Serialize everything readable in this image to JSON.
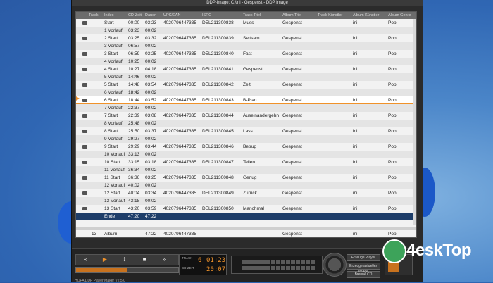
{
  "window": {
    "title": "DDP-Image: C:\\ini - Gespenst - DDP Image"
  },
  "table": {
    "headers": [
      "Track",
      "Index",
      "CD-Zeit",
      "Dauer",
      "UPC/EAN",
      "ISRC",
      "Track Titel",
      "Album Titel",
      "Track Künstler",
      "Album Künstler",
      "Album Genre"
    ],
    "rows": [
      {
        "index": "Start",
        "cd": "00:00",
        "dur": "03:23",
        "upc": "4020796447335",
        "isrc": "DEL211300838",
        "title": "Muss",
        "album": "Gespenst",
        "artist": "ini",
        "genre": "Pop"
      },
      {
        "index": "1 Vorlauf",
        "cd": "03:23",
        "dur": "00:02"
      },
      {
        "index": "2 Start",
        "cd": "03:25",
        "dur": "03:32",
        "upc": "4020796447335",
        "isrc": "DEL211300839",
        "title": "Seltsam",
        "album": "Gespenst",
        "artist": "ini",
        "genre": "Pop"
      },
      {
        "index": "3 Vorlauf",
        "cd": "06:57",
        "dur": "00:02"
      },
      {
        "index": "3 Start",
        "cd": "06:59",
        "dur": "03:25",
        "upc": "4020796447335",
        "isrc": "DEL211300840",
        "title": "Fast",
        "album": "Gespenst",
        "artist": "ini",
        "genre": "Pop"
      },
      {
        "index": "4 Vorlauf",
        "cd": "10:25",
        "dur": "00:02"
      },
      {
        "index": "4 Start",
        "cd": "10:27",
        "dur": "04:18",
        "upc": "4020796447335",
        "isrc": "DEL211300841",
        "title": "Gespenst",
        "album": "Gespenst",
        "artist": "ini",
        "genre": "Pop"
      },
      {
        "index": "5 Vorlauf",
        "cd": "14:46",
        "dur": "00:02"
      },
      {
        "index": "5 Start",
        "cd": "14:48",
        "dur": "03:54",
        "upc": "4020796447335",
        "isrc": "DEL211300842",
        "title": "Zeit",
        "album": "Gespenst",
        "artist": "ini",
        "genre": "Pop"
      },
      {
        "index": "6 Vorlauf",
        "cd": "18:42",
        "dur": "00:02"
      },
      {
        "index": "6 Start",
        "cd": "18:44",
        "dur": "03:52",
        "upc": "4020796447335",
        "isrc": "DEL211300843",
        "title": "B-Plan",
        "album": "Gespenst",
        "artist": "ini",
        "genre": "Pop",
        "selected": true
      },
      {
        "index": "7 Vorlauf",
        "cd": "22:37",
        "dur": "00:02"
      },
      {
        "index": "7 Start",
        "cd": "22:39",
        "dur": "03:08",
        "upc": "4020796447335",
        "isrc": "DEL211300844",
        "title": "Auseinandergehn",
        "album": "Gespenst",
        "artist": "ini",
        "genre": "Pop"
      },
      {
        "index": "8 Vorlauf",
        "cd": "25:48",
        "dur": "00:02"
      },
      {
        "index": "8 Start",
        "cd": "25:50",
        "dur": "03:37",
        "upc": "4020796447335",
        "isrc": "DEL211300845",
        "title": "Lass",
        "album": "Gespenst",
        "artist": "ini",
        "genre": "Pop"
      },
      {
        "index": "9 Vorlauf",
        "cd": "29:27",
        "dur": "00:02"
      },
      {
        "index": "9 Start",
        "cd": "29:29",
        "dur": "03:44",
        "upc": "4020796447335",
        "isrc": "DEL211300846",
        "title": "Betrug",
        "album": "Gespenst",
        "artist": "ini",
        "genre": "Pop"
      },
      {
        "index": "10 Vorlauf",
        "cd": "33:13",
        "dur": "00:02"
      },
      {
        "index": "10 Start",
        "cd": "33:15",
        "dur": "03:18",
        "upc": "4020796447335",
        "isrc": "DEL211300847",
        "title": "Teilen",
        "album": "Gespenst",
        "artist": "ini",
        "genre": "Pop"
      },
      {
        "index": "11 Vorlauf",
        "cd": "36:34",
        "dur": "00:02"
      },
      {
        "index": "11 Start",
        "cd": "36:36",
        "dur": "03:25",
        "upc": "4020796447335",
        "isrc": "DEL211300848",
        "title": "Genug",
        "album": "Gespenst",
        "artist": "ini",
        "genre": "Pop"
      },
      {
        "index": "12 Vorlauf",
        "cd": "40:02",
        "dur": "00:02"
      },
      {
        "index": "12 Start",
        "cd": "40:04",
        "dur": "03:34",
        "upc": "4020796447335",
        "isrc": "DEL211300849",
        "title": "Zurück",
        "album": "Gespenst",
        "artist": "ini",
        "genre": "Pop"
      },
      {
        "index": "13 Vorlauf",
        "cd": "43:18",
        "dur": "00:02"
      },
      {
        "index": "13 Start",
        "cd": "43:20",
        "dur": "03:59",
        "upc": "4020796447335",
        "isrc": "DEL211300850",
        "title": "Manchmal",
        "album": "Gespenst",
        "artist": "ini",
        "genre": "Pop"
      },
      {
        "index": "Ende",
        "cd": "47:20",
        "dur": "47:22",
        "ende": true
      }
    ],
    "album_row": {
      "track": "13",
      "index": "Album",
      "dur": "47:22",
      "upc": "4020796447335",
      "album": "Gespenst",
      "artist": "ini",
      "genre": "Pop"
    }
  },
  "player": {
    "rewind": "«",
    "play": "▶",
    "cue": "⇕",
    "stop": "■",
    "forward": "»",
    "progress_pct": 50,
    "lcd": {
      "track_label": "TRACK",
      "track": "6",
      "track_time": "01:23",
      "cdzeit_label": "CD-ZEIT",
      "cd_time": "20:07"
    },
    "buttons": [
      "Erzeuge Player",
      "Erzeuge aktuelles Image",
      "Brenne CD"
    ],
    "volume_pct": 50
  },
  "footer": {
    "app": "HOFA DDP Player Maker V2.5.0"
  },
  "watermark": {
    "text": "4eskTop"
  }
}
